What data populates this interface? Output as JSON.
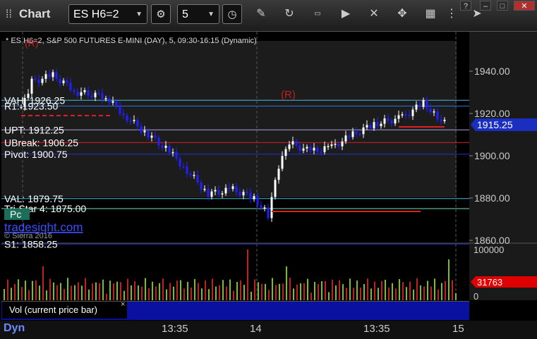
{
  "toolbar": {
    "title": "Chart",
    "symbol": "ES H6=2",
    "interval": "5",
    "icons": [
      "settings-icon",
      "clock-icon",
      "pencil-icon",
      "refresh-icon",
      "account-icon",
      "play-icon",
      "cross-icon",
      "grid-icon",
      "share-icon"
    ]
  },
  "window_buttons": {
    "help": "?",
    "minimize": "–",
    "maximize": "□",
    "close": "✕"
  },
  "chart": {
    "header": "* ES H6=2, S&P 500 FUTURES E-MINI (DAY), 5, 09:30-16:15 (Dynamic)",
    "price_axis_labels": [
      "1940.00",
      "1920.00",
      "1900.00",
      "1880.00",
      "1860.00"
    ],
    "current_price": "1915.25",
    "levels": [
      {
        "label": "VAH: 1926.25",
        "price": 1926.25,
        "color": "#49b8e0"
      },
      {
        "label": "R1: 1923.50",
        "price": 1923.5,
        "color": "#2f6fe0"
      },
      {
        "label": "UPT: 1912.25",
        "price": 1912.25,
        "color": "#b0a0e0"
      },
      {
        "label": "UBreak: 1906.25",
        "price": 1906.25,
        "color": "#e02020"
      },
      {
        "label": "Pivot: 1900.75",
        "price": 1900.75,
        "color": "#2233cc"
      },
      {
        "label": "VAL: 1879.75",
        "price": 1879.75,
        "color": "#49b8e0"
      },
      {
        "label": "Tri-Star 4: 1875.00",
        "price": 1875.0,
        "color": "#70e0c0"
      },
      {
        "label": "S1: 1858.25",
        "price": 1858.25,
        "color": "#2233cc"
      }
    ],
    "annotations": {
      "r_mark": "(R)",
      "pc": "Pc",
      "watermark": "tradesight.com",
      "copyright": "© Sierra 2016"
    },
    "volume_axis": {
      "top": "100000",
      "current": "31763",
      "bottom": "0"
    },
    "time_labels": [
      "13:35",
      "14",
      "13:35",
      "15"
    ]
  },
  "volume_tab": {
    "label": "Vol (current price bar)",
    "close": "×"
  },
  "footer": {
    "dyn": "Dyn"
  },
  "colors": {
    "up": "#ffffff",
    "down": "#2020ff",
    "price_tag": "#1a2fc0",
    "vol_tag": "#e00000"
  }
}
